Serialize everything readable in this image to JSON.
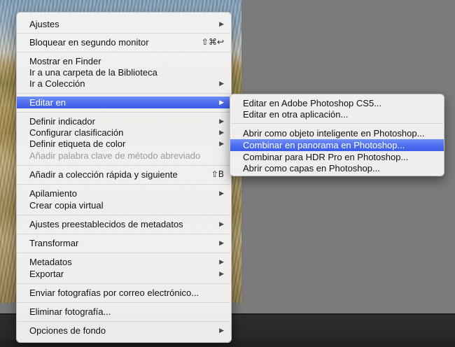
{
  "main_menu": {
    "items": [
      {
        "label": "Ajustes",
        "arrow": "▶"
      },
      {
        "label": "Bloquear en segundo monitor",
        "shortcut": "⇧⌘↩"
      },
      {
        "label": "Mostrar en Finder"
      },
      {
        "label": "Ir a una carpeta de la Biblioteca"
      },
      {
        "label": "Ir a Colección",
        "arrow": "▶"
      },
      {
        "label": "Editar en",
        "arrow": "▶"
      },
      {
        "label": "Definir indicador",
        "arrow": "▶"
      },
      {
        "label": "Configurar clasificación",
        "arrow": "▶"
      },
      {
        "label": "Definir etiqueta de color",
        "arrow": "▶"
      },
      {
        "label": "Añadir palabra clave de método abreviado"
      },
      {
        "label": "Añadir a colección rápida y siguiente",
        "shortcut": "⇧B"
      },
      {
        "label": "Apilamiento",
        "arrow": "▶"
      },
      {
        "label": "Crear copia virtual"
      },
      {
        "label": "Ajustes preestablecidos de metadatos",
        "arrow": "▶"
      },
      {
        "label": "Transformar",
        "arrow": "▶"
      },
      {
        "label": "Metadatos",
        "arrow": "▶"
      },
      {
        "label": "Exportar",
        "arrow": "▶"
      },
      {
        "label": "Enviar fotografías por correo electrónico..."
      },
      {
        "label": "Eliminar fotografía..."
      },
      {
        "label": "Opciones de fondo",
        "arrow": "▶"
      }
    ]
  },
  "submenu": {
    "items": [
      {
        "label": "Editar en Adobe Photoshop CS5..."
      },
      {
        "label": "Editar en otra aplicación..."
      },
      {
        "label": "Abrir como objeto inteligente en Photoshop..."
      },
      {
        "label": "Combinar en panorama en Photoshop..."
      },
      {
        "label": "Combinar para HDR Pro en Photoshop..."
      },
      {
        "label": "Abrir como capas en Photoshop..."
      }
    ]
  },
  "colors": {
    "highlight": "#4f6ff0",
    "menu_background": "#f3f3f3",
    "disabled_text": "#9c9c9c"
  }
}
